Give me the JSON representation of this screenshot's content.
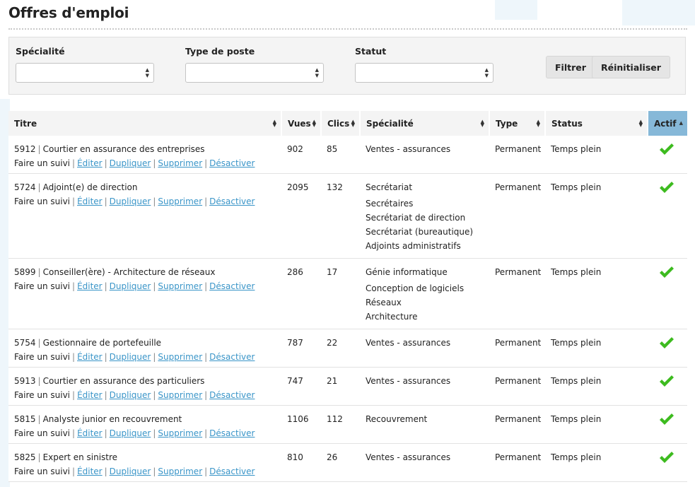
{
  "page": {
    "title": "Offres d'emploi"
  },
  "filters": {
    "specialite_label": "Spécialité",
    "type_label": "Type de poste",
    "statut_label": "Statut",
    "filter_button": "Filtrer",
    "reset_button": "Réinitialiser"
  },
  "table": {
    "headers": {
      "titre": "Titre",
      "vues": "Vues",
      "clics": "Clics",
      "specialite": "Spécialité",
      "type": "Type",
      "status": "Status",
      "actif": "Actif"
    },
    "actions": {
      "follow": "Faire un suivi",
      "edit": "Éditer",
      "duplicate": "Dupliquer",
      "delete": "Supprimer",
      "deactivate": "Désactiver",
      "separator": "|"
    },
    "rows": [
      {
        "id": "5912",
        "title": "Courtier en assurance des entreprises",
        "views": "902",
        "clicks": "85",
        "specialties": [
          "Ventes - assurances"
        ],
        "type": "Permanent",
        "status": "Temps plein",
        "active": true
      },
      {
        "id": "5724",
        "title": "Adjoint(e) de direction",
        "views": "2095",
        "clicks": "132",
        "specialties": [
          "Secrétariat",
          "Secrétaires",
          "Secrétariat de direction",
          "Secrétariat (bureautique)",
          "Adjoints administratifs"
        ],
        "type": "Permanent",
        "status": "Temps plein",
        "active": true
      },
      {
        "id": "5899",
        "title": "Conseiller(ère) - Architecture de réseaux",
        "views": "286",
        "clicks": "17",
        "specialties": [
          "Génie informatique",
          "Conception de logiciels",
          "Réseaux",
          "Architecture"
        ],
        "type": "Permanent",
        "status": "Temps plein",
        "active": true
      },
      {
        "id": "5754",
        "title": "Gestionnaire de portefeuille",
        "views": "787",
        "clicks": "22",
        "specialties": [
          "Ventes - assurances"
        ],
        "type": "Permanent",
        "status": "Temps plein",
        "active": true
      },
      {
        "id": "5913",
        "title": "Courtier en assurance des particuliers",
        "views": "747",
        "clicks": "21",
        "specialties": [
          "Ventes - assurances"
        ],
        "type": "Permanent",
        "status": "Temps plein",
        "active": true
      },
      {
        "id": "5815",
        "title": "Analyste junior en recouvrement",
        "views": "1106",
        "clicks": "112",
        "specialties": [
          "Recouvrement"
        ],
        "type": "Permanent",
        "status": "Temps plein",
        "active": true
      },
      {
        "id": "5825",
        "title": "Expert en sinistre",
        "views": "810",
        "clicks": "26",
        "specialties": [
          "Ventes - assurances"
        ],
        "type": "Permanent",
        "status": "Temps plein",
        "active": true
      }
    ]
  },
  "colors": {
    "accent": "#86b8d8",
    "link": "#3a95c8",
    "check": "#3dbb1f"
  },
  "icons": {
    "active": "check-icon",
    "sort": "sort-both-icon",
    "sort_asc": "sort-asc-icon",
    "select": "select-arrows-icon"
  }
}
